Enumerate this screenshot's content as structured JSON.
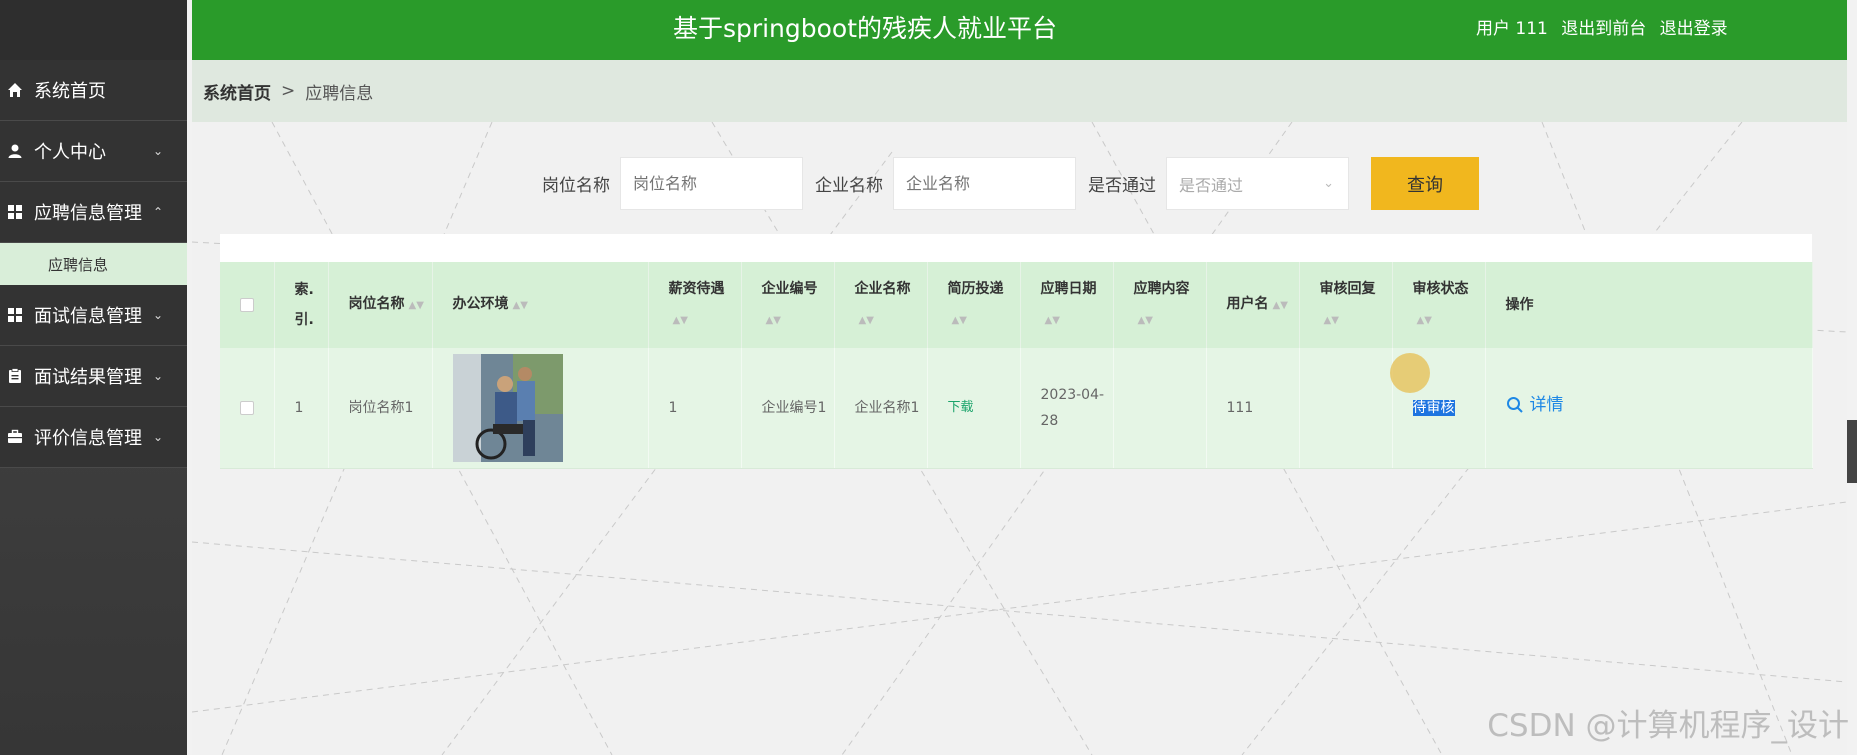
{
  "header": {
    "title": "基于springboot的残疾人就业平台",
    "user_label": "用户 111",
    "back_to_front": "退出到前台",
    "logout": "退出登录"
  },
  "sidebar": {
    "items": [
      {
        "label": "系统首页",
        "icon": "home-icon"
      },
      {
        "label": "个人中心",
        "icon": "user-icon"
      },
      {
        "label": "应聘信息管理",
        "icon": "grid-icon",
        "expanded": true
      },
      {
        "label": "面试信息管理",
        "icon": "grid-icon"
      },
      {
        "label": "面试结果管理",
        "icon": "clipboard-icon"
      },
      {
        "label": "评价信息管理",
        "icon": "briefcase-icon"
      }
    ],
    "subitem": "应聘信息"
  },
  "breadcrumb": {
    "home": "系统首页",
    "separator": ">",
    "current": "应聘信息"
  },
  "search": {
    "job_label": "岗位名称",
    "job_placeholder": "岗位名称",
    "company_label": "企业名称",
    "company_placeholder": "企业名称",
    "pass_label": "是否通过",
    "pass_placeholder": "是否通过",
    "query_button": "查询"
  },
  "table": {
    "headers": [
      "索.引.",
      "岗位名称",
      "办公环境",
      "薪资待遇",
      "企业编号",
      "企业名称",
      "简历投递",
      "应聘日期",
      "应聘内容",
      "用户名",
      "审核回复",
      "审核状态",
      "操作"
    ],
    "rows": [
      {
        "index": "1",
        "job_name": "岗位名称1",
        "salary": "1",
        "company_no": "企业编号1",
        "company_name": "企业名称1",
        "resume": "下载",
        "date": "2023-04-28",
        "content": "",
        "username": "111",
        "reply": "",
        "status": "待审核",
        "action": "详情"
      }
    ]
  },
  "colors": {
    "header_green": "#2a9b2a",
    "query_yellow": "#f1b71e",
    "link_blue": "#1e88e5"
  },
  "watermark": "CSDN @计算机程序_设计"
}
